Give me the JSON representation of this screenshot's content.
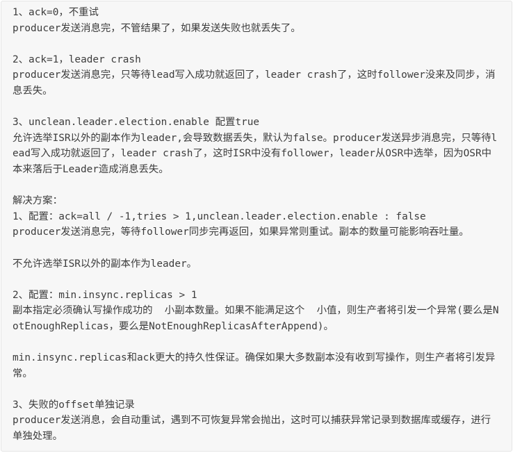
{
  "lines": [
    "1、ack=0，不重试",
    "producer发送消息完，不管结果了，如果发送失败也就丢失了。",
    "",
    "2、ack=1，leader crash",
    "producer发送消息完，只等待lead写入成功就返回了，leader crash了，这时follower没来及同步，消息丢失。",
    "",
    "3、unclean.leader.election.enable 配置true",
    "允许选举ISR以外的副本作为leader,会导致数据丢失，默认为false。producer发送异步消息完，只等待lead写入成功就返回了，leader crash了，这时ISR中没有follower，leader从OSR中选举，因为OSR中本来落后于Leader造成消息丢失。",
    "",
    "解决方案：",
    "1、配置：ack=all / -1,tries > 1,unclean.leader.election.enable : false",
    "producer发送消息完，等待follower同步完再返回，如果异常则重试。副本的数量可能影响吞吐量。",
    "",
    "不允许选举ISR以外的副本作为leader。",
    "",
    "2、配置：min.insync.replicas > 1",
    "副本指定必须确认写操作成功的  小副本数量。如果不能满足这个  小值，则生产者将引发一个异常(要么是NotEnoughReplicas，要么是NotEnoughReplicasAfterAppend)。",
    "",
    "min.insync.replicas和ack更大的持久性保证。确保如果大多数副本没有收到写操作，则生产者将引发异常。",
    "",
    "3、失败的offset单独记录",
    "producer发送消息，会自动重试，遇到不可恢复异常会抛出，这时可以捕获异常记录到数据库或缓存，进行单独处理。"
  ]
}
